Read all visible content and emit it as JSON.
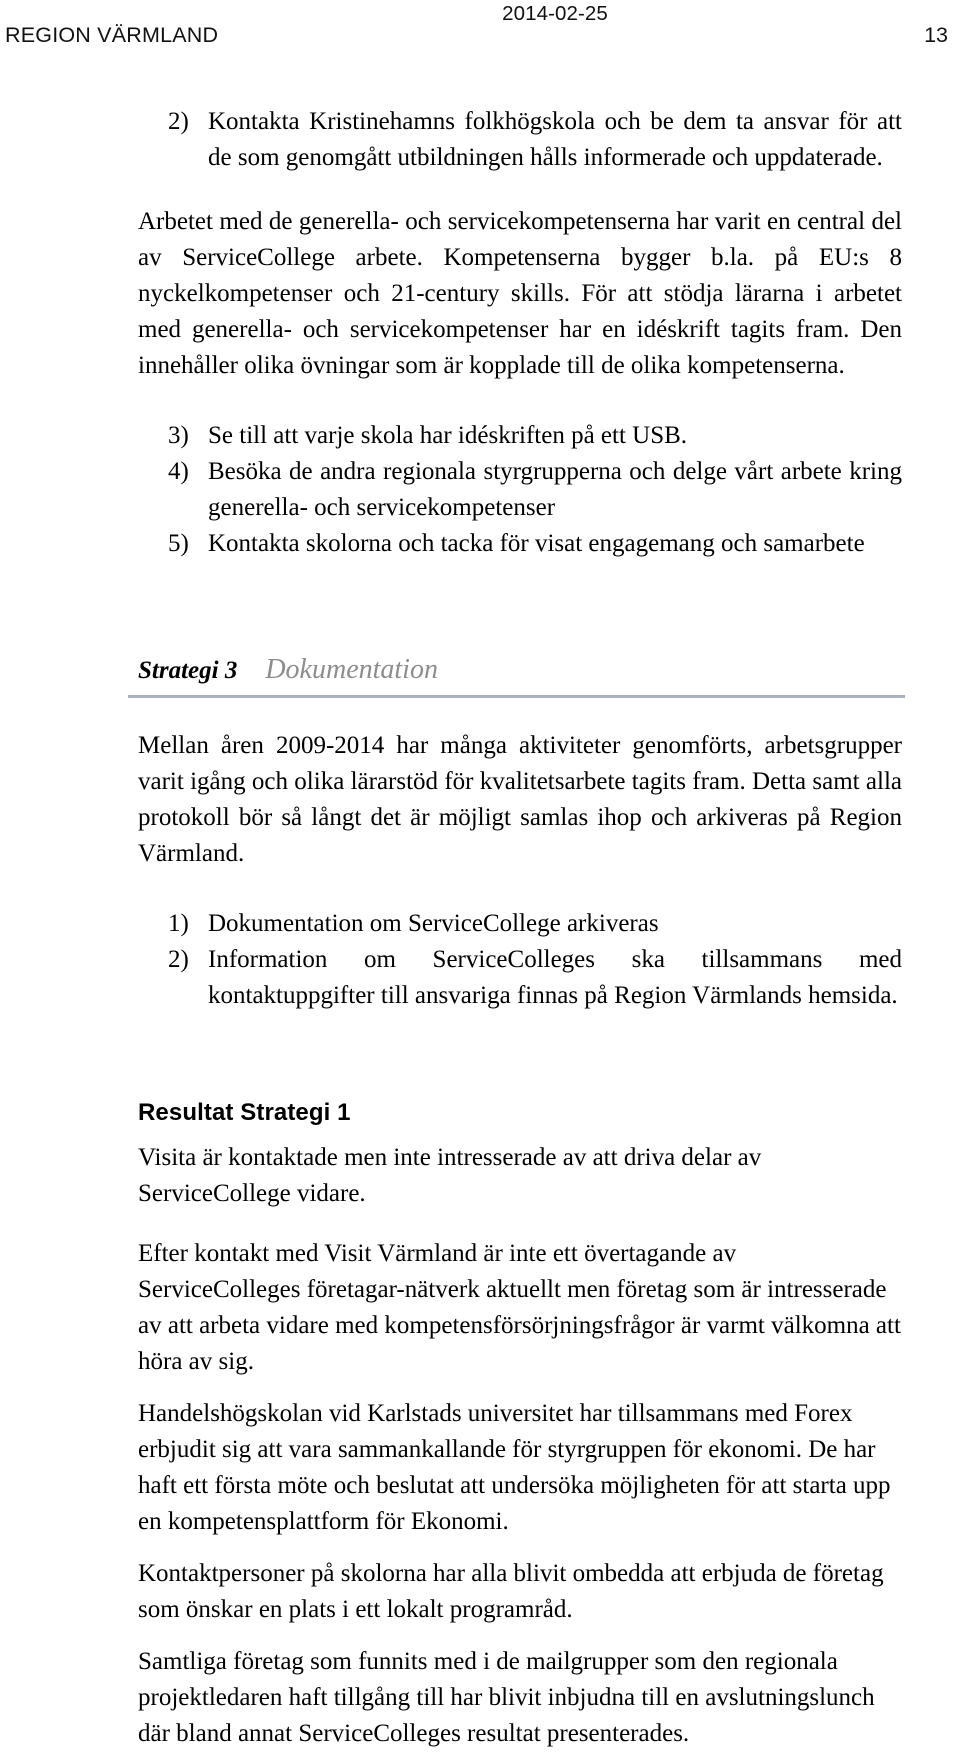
{
  "header": {
    "date": "2014-02-25",
    "organization": "REGION VÄRMLAND",
    "page_number": "13"
  },
  "content": {
    "list_strategy2_continued": [
      {
        "marker": "2)",
        "text": "Kontakta Kristinehamns folkhögskola och be dem ta ansvar för att de som genomgått utbildningen hålls informerade och uppdaterade."
      }
    ],
    "paragraph_generella": "Arbetet med de generella- och servicekompetenserna har varit en central del av ServiceCollege arbete. Kompetenserna bygger b.la. på EU:s 8 nyckelkompetenser och 21-century skills. För att stödja lärarna i arbetet med generella- och servicekompetenser har en idéskrift tagits fram. Den innehåller olika övningar som är kopplade till de olika kompetenserna.",
    "list_actions": [
      {
        "marker": "3)",
        "text": "Se till att varje skola har idéskriften på ett USB."
      },
      {
        "marker": "4)",
        "text": "Besöka de andra regionala styrgrupperna och delge vårt arbete kring generella- och servicekompetenser"
      },
      {
        "marker": "5)",
        "text": "Kontakta skolorna och tacka för visat engagemang och samarbete"
      }
    ],
    "strategy3": {
      "label": "Strategi 3",
      "topic": "Dokumentation"
    },
    "paragraph_dokumentation": "Mellan åren 2009-2014 har många aktiviteter genomförts, arbetsgrupper varit igång och olika lärarstöd för kvalitetsarbete tagits fram. Detta samt alla protokoll bör så långt det är möjligt samlas ihop och arkiveras på Region Värmland.",
    "list_dokumentation": [
      {
        "marker": "1)",
        "text": "Dokumentation om ServiceCollege arkiveras"
      },
      {
        "marker": "2)",
        "text": "Information om ServiceColleges ska tillsammans med kontaktuppgifter till ansvariga finnas på Region Värmlands hemsida."
      }
    ],
    "result_heading": "Resultat Strategi 1",
    "result_paragraphs": [
      "Visita är kontaktade men inte intresserade av att driva delar av ServiceCollege vidare.",
      "Efter kontakt med Visit Värmland är inte ett övertagande av ServiceColleges företagar-nätverk aktuellt men företag som är intresserade av att arbeta vidare med kompetensförsörjningsfrågor är varmt välkomna att höra av sig.",
      "Handelshögskolan vid Karlstads universitet har tillsammans med Forex erbjudit sig att vara sammankallande för styrgruppen för ekonomi. De har haft ett första möte och beslutat att undersöka möjligheten för att starta upp en kompetensplattform för Ekonomi.",
      "Kontaktpersoner på skolorna har alla blivit ombedda att erbjuda de företag som önskar en plats i ett lokalt programråd.",
      "Samtliga företag som funnits med i de mailgrupper som den regionala projektledaren haft tillgång till har blivit inbjudna till en avslutningslunch där bland annat ServiceColleges resultat presenterades."
    ]
  },
  "colors": {
    "rule": "#a9b2bd",
    "topic_text": "#8d8d8d",
    "body_text": "#000000"
  }
}
